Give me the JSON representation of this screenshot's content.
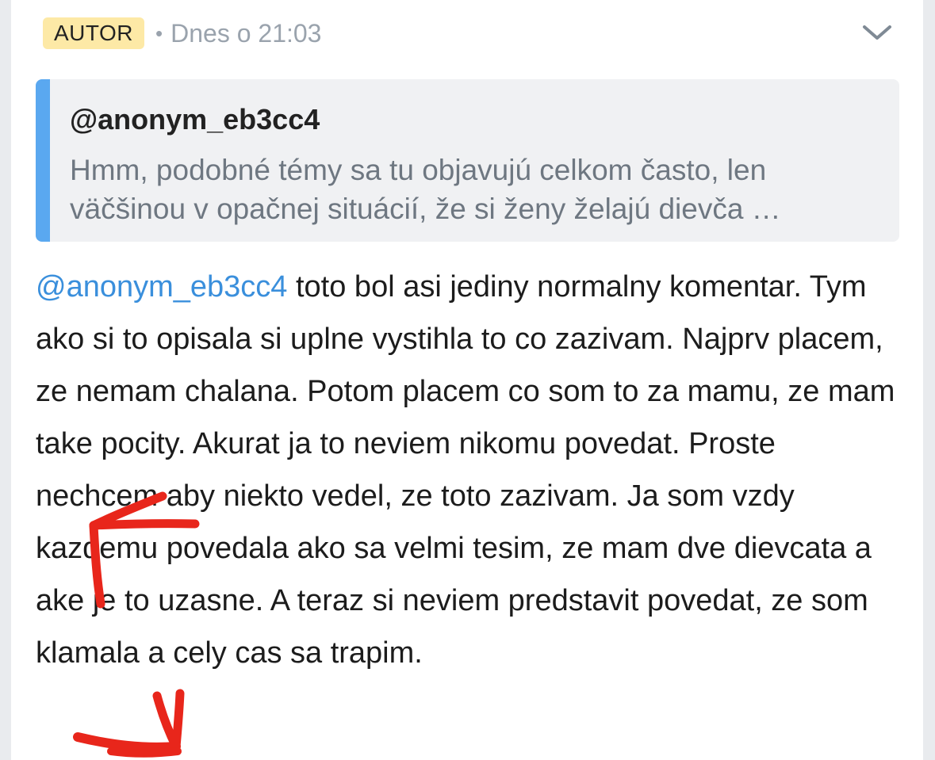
{
  "comment": {
    "badge": "AUTOR",
    "separator": "•",
    "timestamp": "Dnes o 21:03",
    "expand_icon": "chevron-down-icon"
  },
  "quote": {
    "author": "@anonym_eb3cc4",
    "text_line1": "Hmm, podobné témy sa tu objavujú celkom často, len",
    "text_line2": "väčšinou v opačnej situácií, že si ženy želajú dievča …"
  },
  "body": {
    "mention": "@anonym_eb3cc4",
    "text": " toto bol asi jediny normalny komentar. Tym ako si to opisala si uplne vystihla to co zazivam. Najprv placem, ze nemam chalana. Potom placem co som to za mamu, ze mam take pocity. Akurat ja to neviem nikomu povedat. Proste nechcem aby niekto vedel, ze toto zazivam. Ja som vzdy kazdemu povedala ako sa velmi tesim, ze mam dve dievcata a ake je to uzasne. A teraz si neviem predstavit povedat, ze som klamala a cely cas sa trapim."
  },
  "colors": {
    "badge_bg": "#fde9a6",
    "quote_bar": "#5aa8f0",
    "mention": "#3a8fdc",
    "annotation": "#e8261b"
  }
}
